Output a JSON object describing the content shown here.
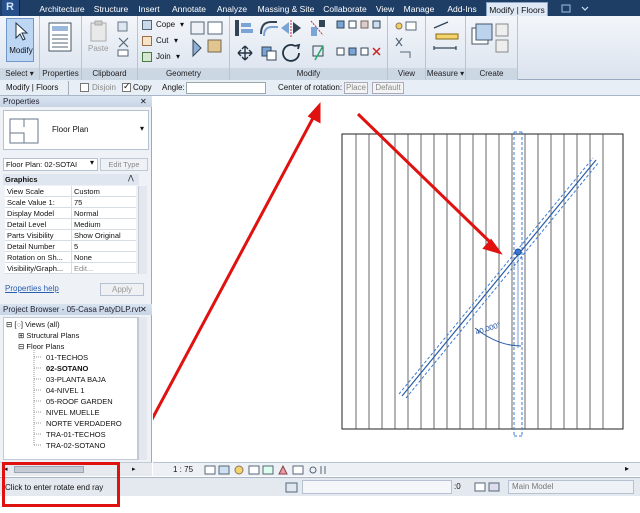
{
  "ribbon": {
    "tabs": [
      "Architecture",
      "Structure",
      "Insert",
      "Annotate",
      "Analyze",
      "Massing & Site",
      "Collaborate",
      "View",
      "Manage",
      "Add-Ins",
      "Modify | Floors"
    ],
    "active_tab": "Modify | Floors",
    "panels": {
      "select": "Select ▾",
      "properties": "Properties",
      "clipboard": "Clipboard",
      "geometry": "Geometry",
      "modify": "Modify",
      "view": "View",
      "measure": "Measure ▾",
      "create": "Create"
    },
    "buttons": {
      "modify": "Modify",
      "paste": "Paste",
      "cope": "Cope",
      "cut": "Cut",
      "join": "Join"
    }
  },
  "options_bar": {
    "context": "Modify | Floors",
    "disjoin": "Disjoin",
    "copy": "Copy",
    "angle_label": "Angle:",
    "angle_value": "",
    "center_label": "Center of rotation:",
    "place": "Place",
    "default": "Default"
  },
  "properties": {
    "title": "Properties",
    "type_name": "Floor Plan",
    "instance_selector": "Floor Plan: 02-SOTAI",
    "edit_type": "Edit Type",
    "group": "Graphics",
    "rows": [
      {
        "k": "View Scale",
        "v": "Custom"
      },
      {
        "k": "Scale Value    1:",
        "v": "75"
      },
      {
        "k": "Display Model",
        "v": "Normal"
      },
      {
        "k": "Detail Level",
        "v": "Medium"
      },
      {
        "k": "Parts Visibility",
        "v": "Show Original"
      },
      {
        "k": "Detail Number",
        "v": "5"
      },
      {
        "k": "Rotation on Sh...",
        "v": "None"
      },
      {
        "k": "Visibility/Graph...",
        "v": "Edit..."
      }
    ],
    "help_link": "Properties help",
    "apply": "Apply"
  },
  "project_browser": {
    "title": "Project Browser - 05-Casa PatyDLP.rvt",
    "views_root": "Views (all)",
    "nodes": [
      "Structural Plans",
      "Floor Plans"
    ],
    "floor_plans": [
      "01-TECHOS",
      "02-SOTANO",
      "03-PLANTA BAJA",
      "04-NIVEL 1",
      "05-ROOF GARDEN",
      "NIVEL MUELLE",
      "NORTE VERDADERO",
      "TRA-01-TECHOS",
      "TRA-02-SOTANO"
    ],
    "active_view": "02-SOTANO"
  },
  "canvas": {
    "angle_dimension": "40.000°"
  },
  "view_bar": {
    "scale": "1 : 75"
  },
  "status": {
    "prompt": "Click to enter rotate end ray",
    "workset_value": ":0",
    "model": "Main Model"
  },
  "colors": {
    "ribbon_dark": "#1e3e66",
    "annotation_red": "#e0120f",
    "selection_blue": "#3c7bd6"
  }
}
